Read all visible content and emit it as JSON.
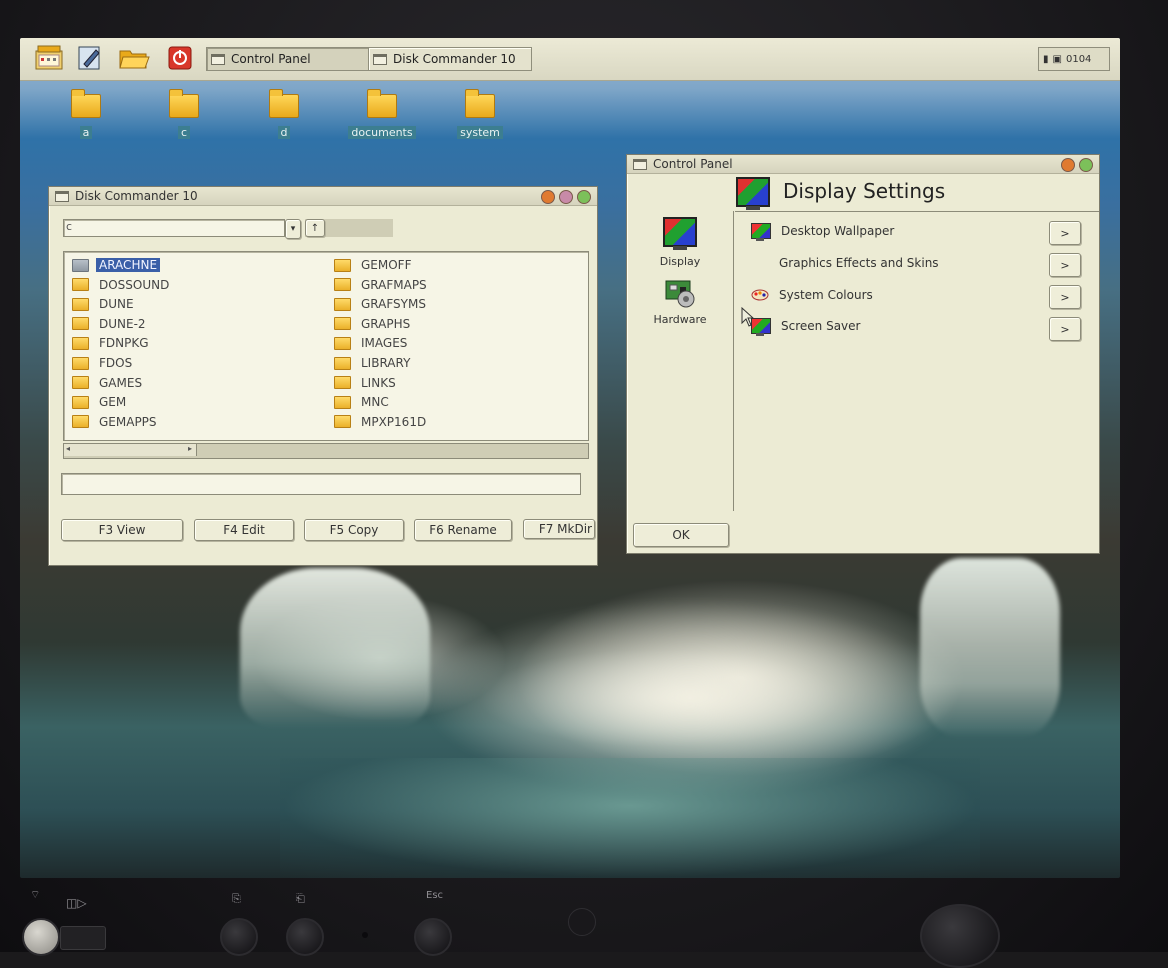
{
  "taskbar": {
    "tasks": [
      {
        "label": "Control Panel",
        "active": true
      },
      {
        "label": "Disk Commander 10",
        "active": false
      }
    ],
    "tray_time": "0104",
    "icons": [
      "calendar-icon",
      "edit-icon",
      "folder-open-icon",
      "power-icon"
    ]
  },
  "desktop": {
    "icons": [
      {
        "label": "a"
      },
      {
        "label": "c"
      },
      {
        "label": "d"
      },
      {
        "label": "documents"
      },
      {
        "label": "system"
      }
    ]
  },
  "disk_commander": {
    "title": "Disk Commander 10",
    "path_value": "c",
    "status_value": "",
    "left_column": [
      "ARACHNE",
      "DOSSOUND",
      "DUNE",
      "DUNE-2",
      "FDNPKG",
      "FDOS",
      "GAMES",
      "GEM",
      "GEMAPPS"
    ],
    "right_column": [
      "GEMOFF",
      "GRAFMAPS",
      "GRAFSYMS",
      "GRAPHS",
      "IMAGES",
      "LIBRARY",
      "LINKS",
      "MNC",
      "MPXP161D"
    ],
    "selected": "ARACHNE",
    "buttons": [
      "F3 View",
      "F4 Edit",
      "F5 Copy",
      "F6 Rename",
      "F7 MkDir"
    ]
  },
  "control_panel": {
    "title": "Control Panel",
    "heading": "Display Settings",
    "sidebar": [
      {
        "label": "Display",
        "icon": "display-icon"
      },
      {
        "label": "Hardware",
        "icon": "hardware-icon"
      }
    ],
    "items": [
      {
        "label": "Desktop Wallpaper",
        "icon": "monitor-icon"
      },
      {
        "label": "Graphics Effects and Skins",
        "icon": ""
      },
      {
        "label": "System Colours",
        "icon": "palette-icon"
      },
      {
        "label": "Screen Saver",
        "icon": "monitor-icon"
      }
    ],
    "arrow_label": ">",
    "ok_label": "OK"
  },
  "bezel": {
    "esc_label": "Esc"
  }
}
